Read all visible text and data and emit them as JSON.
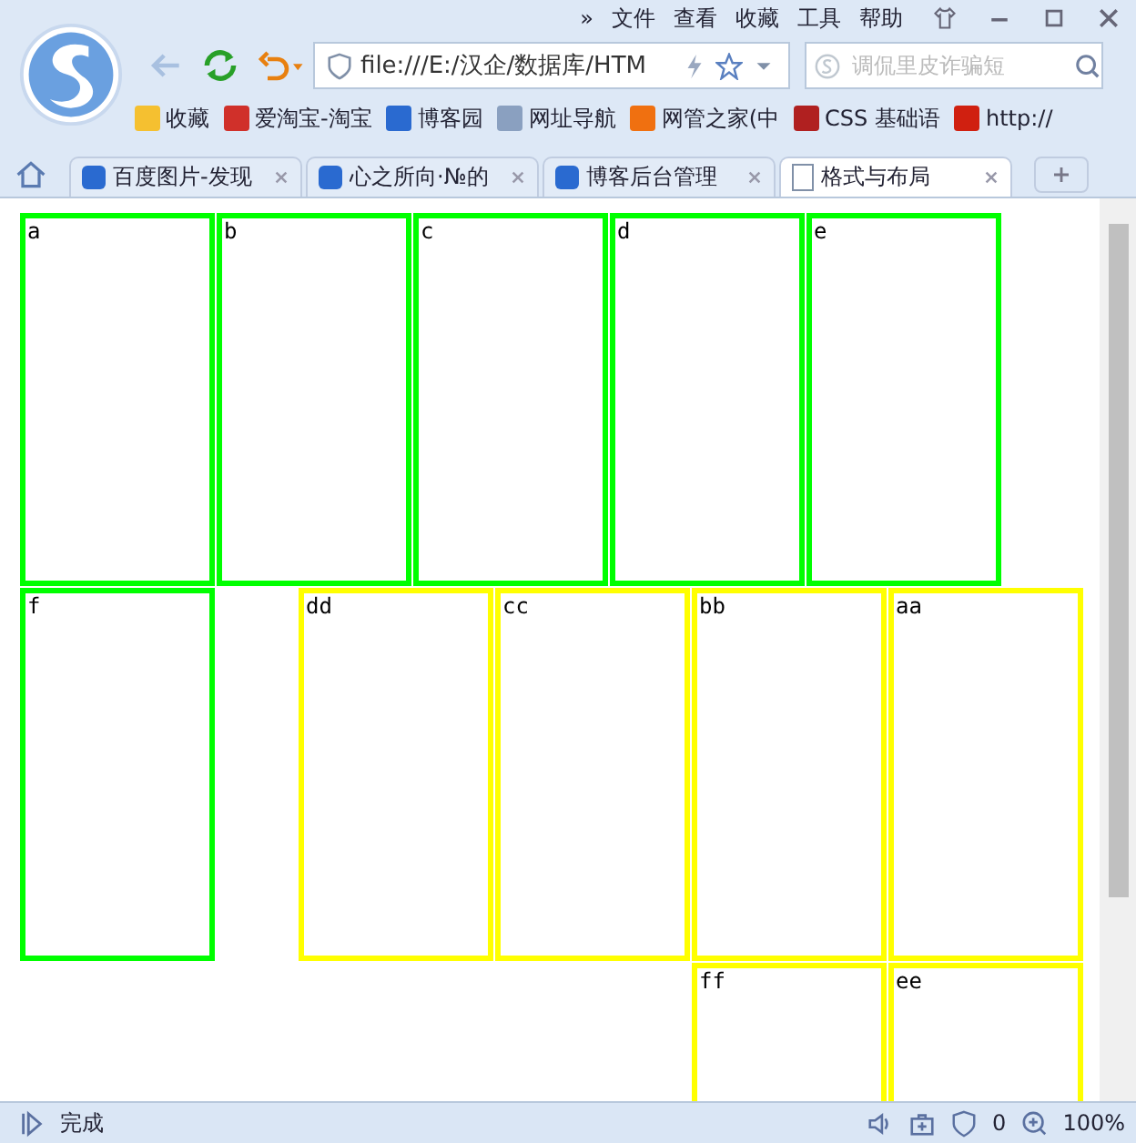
{
  "menu": [
    "»",
    "文件",
    "查看",
    "收藏",
    "工具",
    "帮助"
  ],
  "address": {
    "value": "file:///E:/汉企/数据库/HTM"
  },
  "search": {
    "placeholder": "调侃里皮诈骗短"
  },
  "bookmarks": [
    {
      "label": "收藏",
      "color": "#f5c030"
    },
    {
      "label": "爱淘宝-淘宝",
      "color": "#d0302a"
    },
    {
      "label": "博客园",
      "color": "#2a6ad0"
    },
    {
      "label": "网址导航",
      "color": "#8aa0c0"
    },
    {
      "label": "网管之家(中",
      "color": "#f07010"
    },
    {
      "label": "CSS 基础语",
      "color": "#b02020"
    },
    {
      "label": "http://",
      "color": "#d02010"
    }
  ],
  "tabs": [
    {
      "label": "百度图片-发现",
      "selected": false
    },
    {
      "label": "心之所向·№的",
      "selected": false
    },
    {
      "label": "博客后台管理",
      "selected": false
    },
    {
      "label": "格式与布局",
      "selected": true
    }
  ],
  "rows": [
    {
      "left": [
        {
          "label": "a",
          "color": "#00ff00"
        },
        {
          "label": "b",
          "color": "#00ff00"
        },
        {
          "label": "c",
          "color": "#00ff00"
        },
        {
          "label": "d",
          "color": "#00ff00"
        },
        {
          "label": "e",
          "color": "#00ff00"
        }
      ],
      "right": []
    },
    {
      "left": [
        {
          "label": "f",
          "color": "#00ff00"
        }
      ],
      "right": [
        {
          "label": "dd",
          "color": "#ffff00"
        },
        {
          "label": "cc",
          "color": "#ffff00"
        },
        {
          "label": "bb",
          "color": "#ffff00"
        },
        {
          "label": "aa",
          "color": "#ffff00"
        }
      ]
    },
    {
      "left": [],
      "right": [
        {
          "label": "ff",
          "color": "#ffff00"
        },
        {
          "label": "ee",
          "color": "#ffff00"
        }
      ]
    }
  ],
  "status": {
    "text": "完成",
    "ad_count": "0",
    "zoom": "100%"
  }
}
